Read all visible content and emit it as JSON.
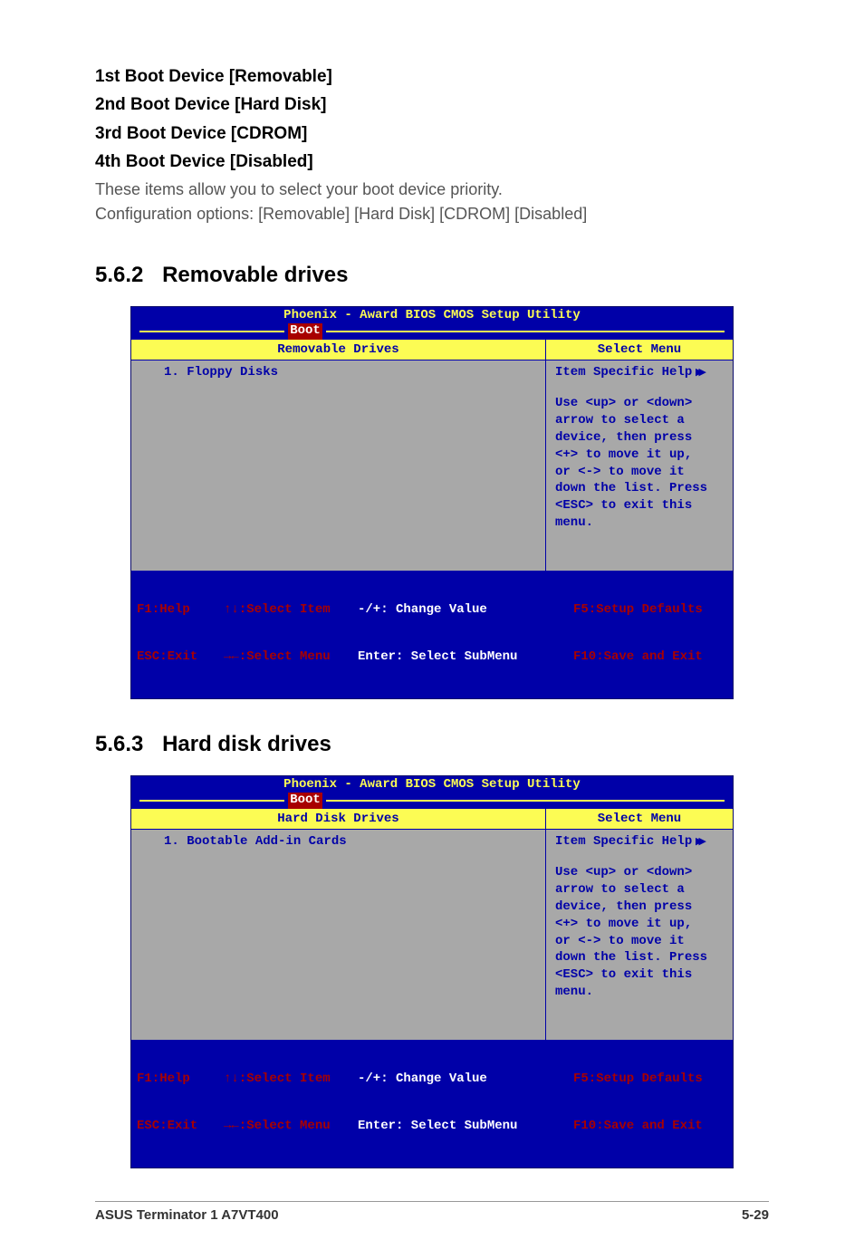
{
  "boot_items": {
    "item1": "1st Boot Device [Removable]",
    "item2": "2nd Boot Device [Hard Disk]",
    "item3": "3rd Boot Device [CDROM]",
    "item4": "4th Boot Device [Disabled]",
    "desc_line1": "These items allow you to select your boot device priority.",
    "desc_line2": "Configuration options: [Removable] [Hard Disk] [CDROM] [Disabled]"
  },
  "sec562": {
    "num": "5.6.2",
    "title": "Removable drives"
  },
  "sec563": {
    "num": "5.6.3",
    "title": "Hard disk drives"
  },
  "bios1": {
    "util_title": "Phoenix - Award BIOS CMOS Setup Utility",
    "tab": "Boot",
    "left_header": "Removable Drives",
    "right_header": "Select Menu",
    "left_item": "1. Floppy Disks",
    "help_title": "Item Specific Help",
    "help_arrow": "▸▸",
    "help1": "Use <up> or <down>",
    "help2": "arrow to select a",
    "help3": "device, then press",
    "help4": "<+> to move it up,",
    "help5": "or <-> to move it",
    "help6": "down the list. Press",
    "help7": "<ESC> to exit this",
    "help8": "menu."
  },
  "bios2": {
    "util_title": "Phoenix - Award BIOS CMOS Setup Utility",
    "tab": "Boot",
    "left_header": "Hard Disk Drives",
    "right_header": "Select Menu",
    "left_item": "1. Bootable Add-in Cards",
    "help_title": "Item Specific Help",
    "help_arrow": "▸▸",
    "help1": "Use <up> or <down>",
    "help2": "arrow to select a",
    "help3": "device, then press",
    "help4": "<+> to move it up,",
    "help5": "or <-> to move it",
    "help6": "down the list. Press",
    "help7": "<ESC> to exit this",
    "help8": "menu."
  },
  "bios_footer": {
    "a1": "F1:Help",
    "a2": "ESC:Exit",
    "b1": "↑↓:Select Item",
    "b2": "→←:Select Menu",
    "c1": "-/+: Change Value",
    "c2": "Enter: Select SubMenu",
    "d1": "F5:Setup Defaults",
    "d2": "F10:Save and Exit"
  },
  "page_footer": {
    "left": "ASUS Terminator 1 A7VT400",
    "right": "5-29"
  }
}
